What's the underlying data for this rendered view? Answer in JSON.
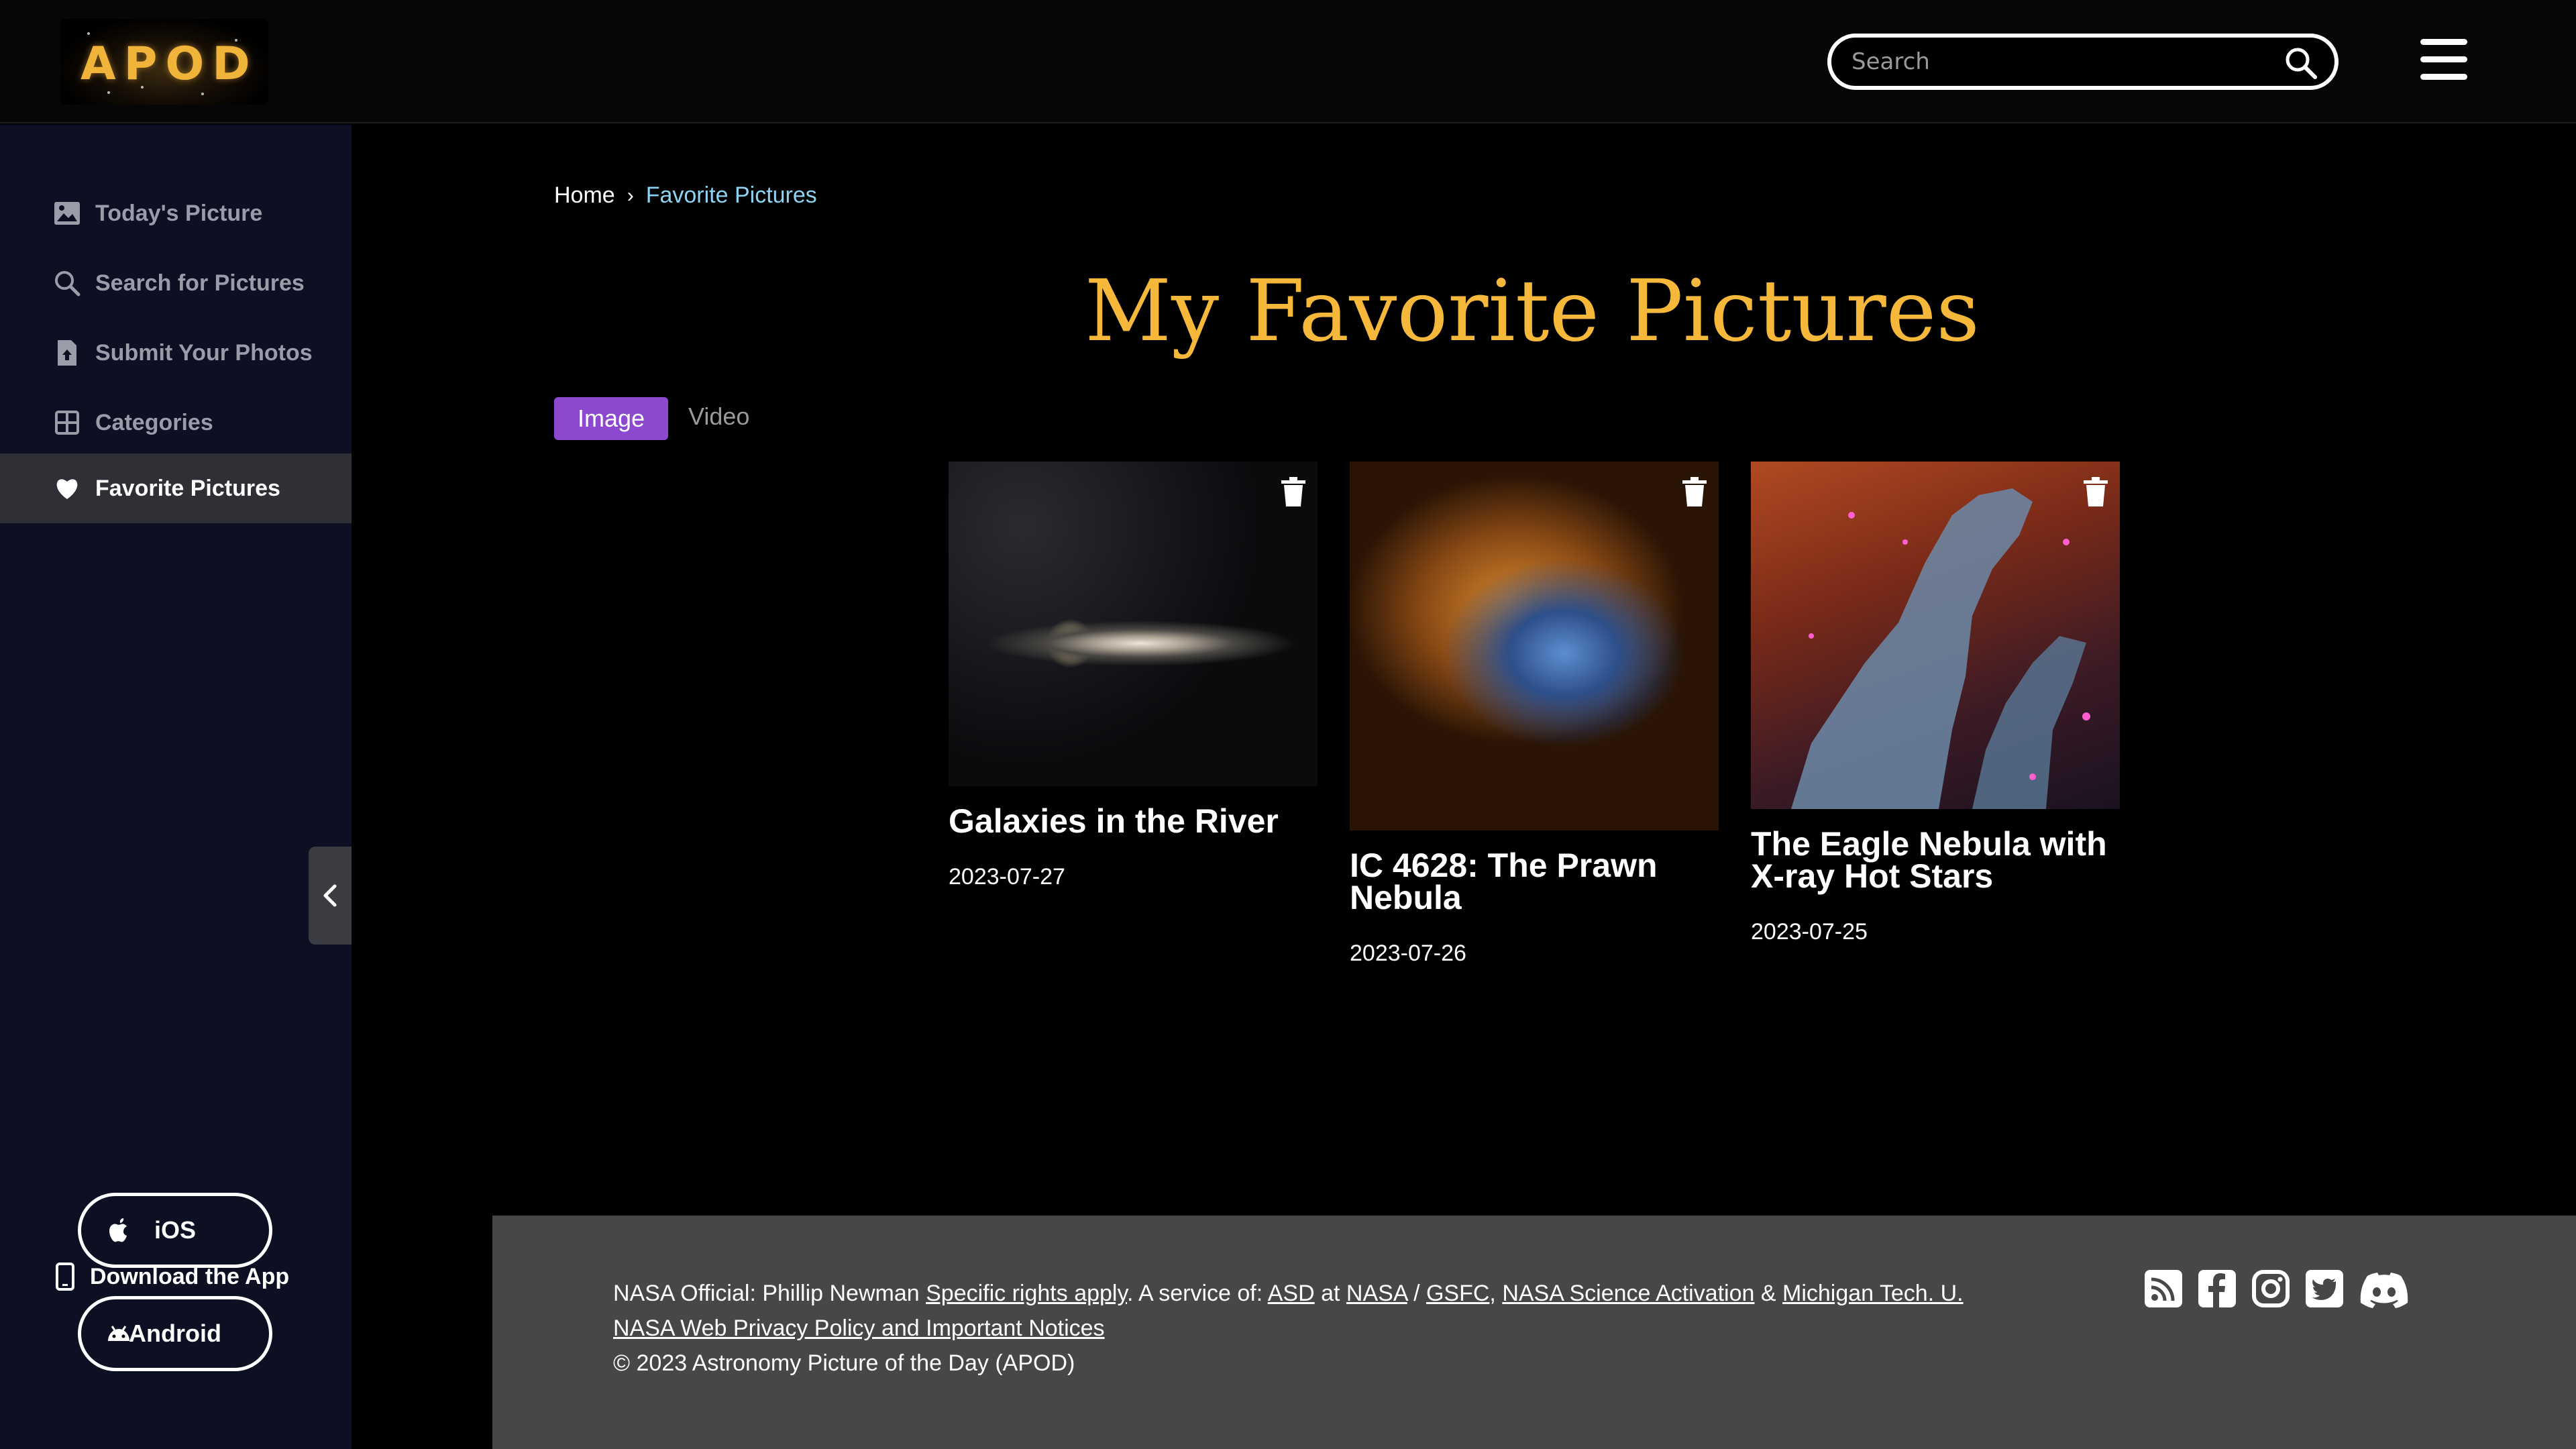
{
  "header": {
    "logo_text": "APOD",
    "search_placeholder": "Search"
  },
  "sidebar": {
    "items": [
      {
        "label": "Today's Picture",
        "icon": "image-icon"
      },
      {
        "label": "Search for Pictures",
        "icon": "search-icon"
      },
      {
        "label": "Submit Your Photos",
        "icon": "upload-file-icon"
      },
      {
        "label": "Categories",
        "icon": "grid-icon"
      },
      {
        "label": "Favorite Pictures",
        "icon": "heart-icon",
        "active": true
      }
    ],
    "download_title": "Download the App",
    "ios_label": "iOS",
    "android_label": "Android"
  },
  "breadcrumb": {
    "home": "Home",
    "current": "Favorite Pictures"
  },
  "main": {
    "title": "My Favorite Pictures",
    "tabs": [
      {
        "label": "Image",
        "active": true
      },
      {
        "label": "Video",
        "active": false
      }
    ],
    "cards": [
      {
        "title": "Galaxies in the River",
        "date": "2023-07-27"
      },
      {
        "title": "IC 4628: The Prawn Nebula",
        "date": "2023-07-26"
      },
      {
        "title": "The Eagle Nebula with X-ray Hot Stars",
        "date": "2023-07-25"
      }
    ]
  },
  "footer": {
    "prefix": "NASA Official: Phillip Newman ",
    "rights_link": "Specific rights apply",
    "service_text": ". A service of: ",
    "asd": "ASD",
    "at": " at ",
    "nasa": "NASA",
    "slash": " / ",
    "gsfc": "GSFC",
    "comma": ", ",
    "activation": "NASA Science Activation",
    "amp": " & ",
    "michigan": "Michigan Tech. U.",
    "privacy": "NASA Web Privacy Policy and Important Notices",
    "copyright": "© 2023 Astronomy Picture of the Day (APOD)"
  },
  "colors": {
    "accent_title": "#f5b83b",
    "tab_active": "#8d48d0",
    "breadcrumb_current": "#8fd3f4",
    "sidebar_bg": "#0d0f22",
    "footer_bg": "#474747"
  }
}
